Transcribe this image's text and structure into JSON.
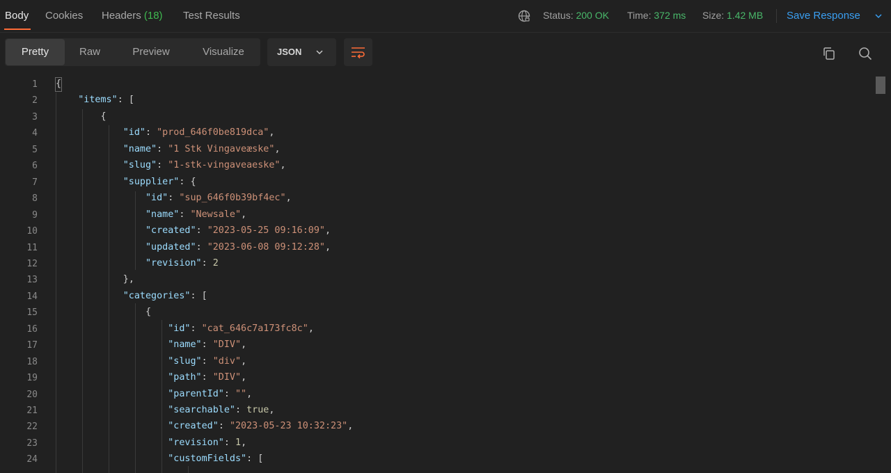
{
  "tabs": [
    {
      "label": "Body"
    },
    {
      "label": "Cookies"
    },
    {
      "label": "Headers",
      "count": "(18)"
    },
    {
      "label": "Test Results"
    }
  ],
  "status": {
    "status_label": "Status:",
    "status_value": "200 OK",
    "time_label": "Time:",
    "time_value": "372 ms",
    "size_label": "Size:",
    "size_value": "1.42 MB"
  },
  "save_response": "Save Response",
  "view_modes": [
    "Pretty",
    "Raw",
    "Preview",
    "Visualize"
  ],
  "format": "JSON",
  "icons": {
    "globe": "globe-icon",
    "chevron": "chevron-down-icon",
    "wrap": "wrap-lines-icon",
    "copy": "copy-icon",
    "search": "search-icon"
  },
  "colors": {
    "accent": "#ff6c37",
    "link": "#3a9ff2",
    "success": "#49b86a",
    "key": "#9cdcfe",
    "string": "#ce9178"
  },
  "code_lines": [
    {
      "n": "1",
      "tokens": [
        {
          "t": "b",
          "v": "{"
        }
      ]
    },
    {
      "n": "2",
      "tokens": [
        {
          "t": "p",
          "v": "    "
        },
        {
          "t": "k",
          "v": "\"items\""
        },
        {
          "t": "p",
          "v": ": "
        },
        {
          "t": "b",
          "v": "["
        }
      ]
    },
    {
      "n": "3",
      "tokens": [
        {
          "t": "p",
          "v": "        "
        },
        {
          "t": "b",
          "v": "{"
        }
      ]
    },
    {
      "n": "4",
      "tokens": [
        {
          "t": "p",
          "v": "            "
        },
        {
          "t": "k",
          "v": "\"id\""
        },
        {
          "t": "p",
          "v": ": "
        },
        {
          "t": "s",
          "v": "\"prod_646f0be819dca\""
        },
        {
          "t": "p",
          "v": ","
        }
      ]
    },
    {
      "n": "5",
      "tokens": [
        {
          "t": "p",
          "v": "            "
        },
        {
          "t": "k",
          "v": "\"name\""
        },
        {
          "t": "p",
          "v": ": "
        },
        {
          "t": "s",
          "v": "\"1 Stk Vingaveæske\""
        },
        {
          "t": "p",
          "v": ","
        }
      ]
    },
    {
      "n": "6",
      "tokens": [
        {
          "t": "p",
          "v": "            "
        },
        {
          "t": "k",
          "v": "\"slug\""
        },
        {
          "t": "p",
          "v": ": "
        },
        {
          "t": "s",
          "v": "\"1-stk-vingaveaeske\""
        },
        {
          "t": "p",
          "v": ","
        }
      ]
    },
    {
      "n": "7",
      "tokens": [
        {
          "t": "p",
          "v": "            "
        },
        {
          "t": "k",
          "v": "\"supplier\""
        },
        {
          "t": "p",
          "v": ": "
        },
        {
          "t": "b",
          "v": "{"
        }
      ]
    },
    {
      "n": "8",
      "tokens": [
        {
          "t": "p",
          "v": "                "
        },
        {
          "t": "k",
          "v": "\"id\""
        },
        {
          "t": "p",
          "v": ": "
        },
        {
          "t": "s",
          "v": "\"sup_646f0b39bf4ec\""
        },
        {
          "t": "p",
          "v": ","
        }
      ]
    },
    {
      "n": "9",
      "tokens": [
        {
          "t": "p",
          "v": "                "
        },
        {
          "t": "k",
          "v": "\"name\""
        },
        {
          "t": "p",
          "v": ": "
        },
        {
          "t": "s",
          "v": "\"Newsale\""
        },
        {
          "t": "p",
          "v": ","
        }
      ]
    },
    {
      "n": "10",
      "tokens": [
        {
          "t": "p",
          "v": "                "
        },
        {
          "t": "k",
          "v": "\"created\""
        },
        {
          "t": "p",
          "v": ": "
        },
        {
          "t": "s",
          "v": "\"2023-05-25 09:16:09\""
        },
        {
          "t": "p",
          "v": ","
        }
      ]
    },
    {
      "n": "11",
      "tokens": [
        {
          "t": "p",
          "v": "                "
        },
        {
          "t": "k",
          "v": "\"updated\""
        },
        {
          "t": "p",
          "v": ": "
        },
        {
          "t": "s",
          "v": "\"2023-06-08 09:12:28\""
        },
        {
          "t": "p",
          "v": ","
        }
      ]
    },
    {
      "n": "12",
      "tokens": [
        {
          "t": "p",
          "v": "                "
        },
        {
          "t": "k",
          "v": "\"revision\""
        },
        {
          "t": "p",
          "v": ": "
        },
        {
          "t": "n",
          "v": "2"
        }
      ]
    },
    {
      "n": "13",
      "tokens": [
        {
          "t": "p",
          "v": "            "
        },
        {
          "t": "b",
          "v": "}"
        },
        {
          "t": "p",
          "v": ","
        }
      ]
    },
    {
      "n": "14",
      "tokens": [
        {
          "t": "p",
          "v": "            "
        },
        {
          "t": "k",
          "v": "\"categories\""
        },
        {
          "t": "p",
          "v": ": "
        },
        {
          "t": "b",
          "v": "["
        }
      ]
    },
    {
      "n": "15",
      "tokens": [
        {
          "t": "p",
          "v": "                "
        },
        {
          "t": "b",
          "v": "{"
        }
      ]
    },
    {
      "n": "16",
      "tokens": [
        {
          "t": "p",
          "v": "                    "
        },
        {
          "t": "k",
          "v": "\"id\""
        },
        {
          "t": "p",
          "v": ": "
        },
        {
          "t": "s",
          "v": "\"cat_646c7a173fc8c\""
        },
        {
          "t": "p",
          "v": ","
        }
      ]
    },
    {
      "n": "17",
      "tokens": [
        {
          "t": "p",
          "v": "                    "
        },
        {
          "t": "k",
          "v": "\"name\""
        },
        {
          "t": "p",
          "v": ": "
        },
        {
          "t": "s",
          "v": "\"DIV\""
        },
        {
          "t": "p",
          "v": ","
        }
      ]
    },
    {
      "n": "18",
      "tokens": [
        {
          "t": "p",
          "v": "                    "
        },
        {
          "t": "k",
          "v": "\"slug\""
        },
        {
          "t": "p",
          "v": ": "
        },
        {
          "t": "s",
          "v": "\"div\""
        },
        {
          "t": "p",
          "v": ","
        }
      ]
    },
    {
      "n": "19",
      "tokens": [
        {
          "t": "p",
          "v": "                    "
        },
        {
          "t": "k",
          "v": "\"path\""
        },
        {
          "t": "p",
          "v": ": "
        },
        {
          "t": "s",
          "v": "\"DIV\""
        },
        {
          "t": "p",
          "v": ","
        }
      ]
    },
    {
      "n": "20",
      "tokens": [
        {
          "t": "p",
          "v": "                    "
        },
        {
          "t": "k",
          "v": "\"parentId\""
        },
        {
          "t": "p",
          "v": ": "
        },
        {
          "t": "s",
          "v": "\"\""
        },
        {
          "t": "p",
          "v": ","
        }
      ]
    },
    {
      "n": "21",
      "tokens": [
        {
          "t": "p",
          "v": "                    "
        },
        {
          "t": "k",
          "v": "\"searchable\""
        },
        {
          "t": "p",
          "v": ": "
        },
        {
          "t": "n",
          "v": "true"
        },
        {
          "t": "p",
          "v": ","
        }
      ]
    },
    {
      "n": "22",
      "tokens": [
        {
          "t": "p",
          "v": "                    "
        },
        {
          "t": "k",
          "v": "\"created\""
        },
        {
          "t": "p",
          "v": ": "
        },
        {
          "t": "s",
          "v": "\"2023-05-23 10:32:23\""
        },
        {
          "t": "p",
          "v": ","
        }
      ]
    },
    {
      "n": "23",
      "tokens": [
        {
          "t": "p",
          "v": "                    "
        },
        {
          "t": "k",
          "v": "\"revision\""
        },
        {
          "t": "p",
          "v": ": "
        },
        {
          "t": "n",
          "v": "1"
        },
        {
          "t": "p",
          "v": ","
        }
      ]
    },
    {
      "n": "24",
      "tokens": [
        {
          "t": "p",
          "v": "                    "
        },
        {
          "t": "k",
          "v": "\"customFields\""
        },
        {
          "t": "p",
          "v": ": "
        },
        {
          "t": "b",
          "v": "["
        }
      ]
    }
  ]
}
